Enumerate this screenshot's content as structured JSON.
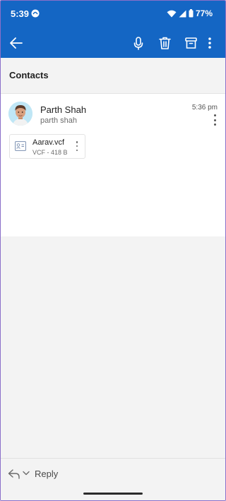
{
  "status_bar": {
    "time": "5:39",
    "battery": "77%"
  },
  "toolbar": {
    "back_icon": "arrow-left-icon",
    "mic_icon": "microphone-icon",
    "delete_icon": "trash-icon",
    "archive_icon": "archive-icon",
    "more_icon": "more-vertical-icon",
    "color": "#1466c4"
  },
  "subject": "Contacts",
  "message": {
    "sender_name": "Parth Shah",
    "sender_email": "parth shah",
    "time": "5:36 pm",
    "attachment": {
      "name": "Aarav.vcf",
      "meta": "VCF - 418 B",
      "icon": "contact-card-icon"
    }
  },
  "reply": {
    "label": "Reply",
    "icon": "reply-icon"
  }
}
